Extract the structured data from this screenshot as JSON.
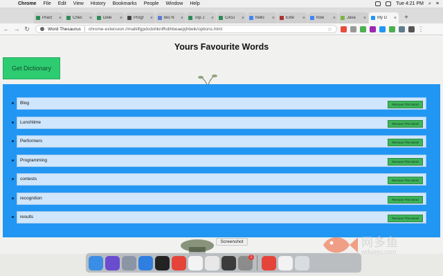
{
  "menubar": {
    "app_name": "Chrome",
    "menus": [
      "File",
      "Edit",
      "View",
      "History",
      "Bookmarks",
      "People",
      "Window",
      "Help"
    ],
    "clock": "Tue 4:21 PM",
    "battery_icon": "battery-icon",
    "wifi_icon": "wifi-icon"
  },
  "tabs": [
    {
      "label": "Pract",
      "favicon_color": "#2e8b57"
    },
    {
      "label": "Chec",
      "favicon_color": "#2e8b57"
    },
    {
      "label": "Dele",
      "favicon_color": "#2e8b57"
    },
    {
      "label": "Progr",
      "favicon_color": "#444444"
    },
    {
      "label": "Bio N",
      "favicon_color": "#5b7bd5"
    },
    {
      "label": "Top J",
      "favicon_color": "#2e8b57"
    },
    {
      "label": "Circu",
      "favicon_color": "#2e8b57"
    },
    {
      "label": "hello",
      "favicon_color": "#4285f4"
    },
    {
      "label": "Exte",
      "favicon_color": "#a33"
    },
    {
      "label": "how",
      "favicon_color": "#4285f4"
    },
    {
      "label": "Java",
      "favicon_color": "#7cb342"
    },
    {
      "label": "My D",
      "favicon_color": "#2196f3",
      "active": true
    }
  ],
  "address_bar": {
    "site_name": "Word Thesaurus",
    "url": "chrome-extension://malklfgpdcdohknlfhdihbeaepjhbeik/options.html"
  },
  "page": {
    "title": "Yours Favourite Words",
    "get_dictionary_label": "Get Dictionary",
    "remove_label": "Remove This Word",
    "words": [
      "Blog",
      "Lunchtime",
      "Performers",
      "Programming",
      "contests",
      "recognition",
      "results"
    ]
  },
  "overlay": {
    "screenshot_label": "Screenshot"
  },
  "dock": {
    "apps": [
      {
        "name": "finder-icon",
        "color": "#3a8ee6"
      },
      {
        "name": "siri-icon",
        "color": "#6a4ccf"
      },
      {
        "name": "launchpad-icon",
        "color": "#8a96a6"
      },
      {
        "name": "safari-icon",
        "color": "#2f7fe0"
      },
      {
        "name": "terminal-icon",
        "color": "#222222"
      },
      {
        "name": "chrome-icon",
        "color": "#e4443a"
      },
      {
        "name": "preview-icon",
        "color": "#f3f3f3"
      },
      {
        "name": "screenshot-icon",
        "color": "#e8e8e8"
      },
      {
        "name": "sublime-icon",
        "color": "#3c3c3c"
      },
      {
        "name": "system-preferences-icon",
        "color": "#8c8c8c",
        "badge": "1"
      },
      {
        "name": "chrome-icon-2",
        "color": "#e4443a"
      },
      {
        "name": "itunes-icon",
        "color": "#f2f2f2"
      },
      {
        "name": "trash-icon",
        "color": "#d9dde2"
      }
    ]
  },
  "watermark": {
    "brand": "网多鱼",
    "url": "wduoyu.com"
  }
}
